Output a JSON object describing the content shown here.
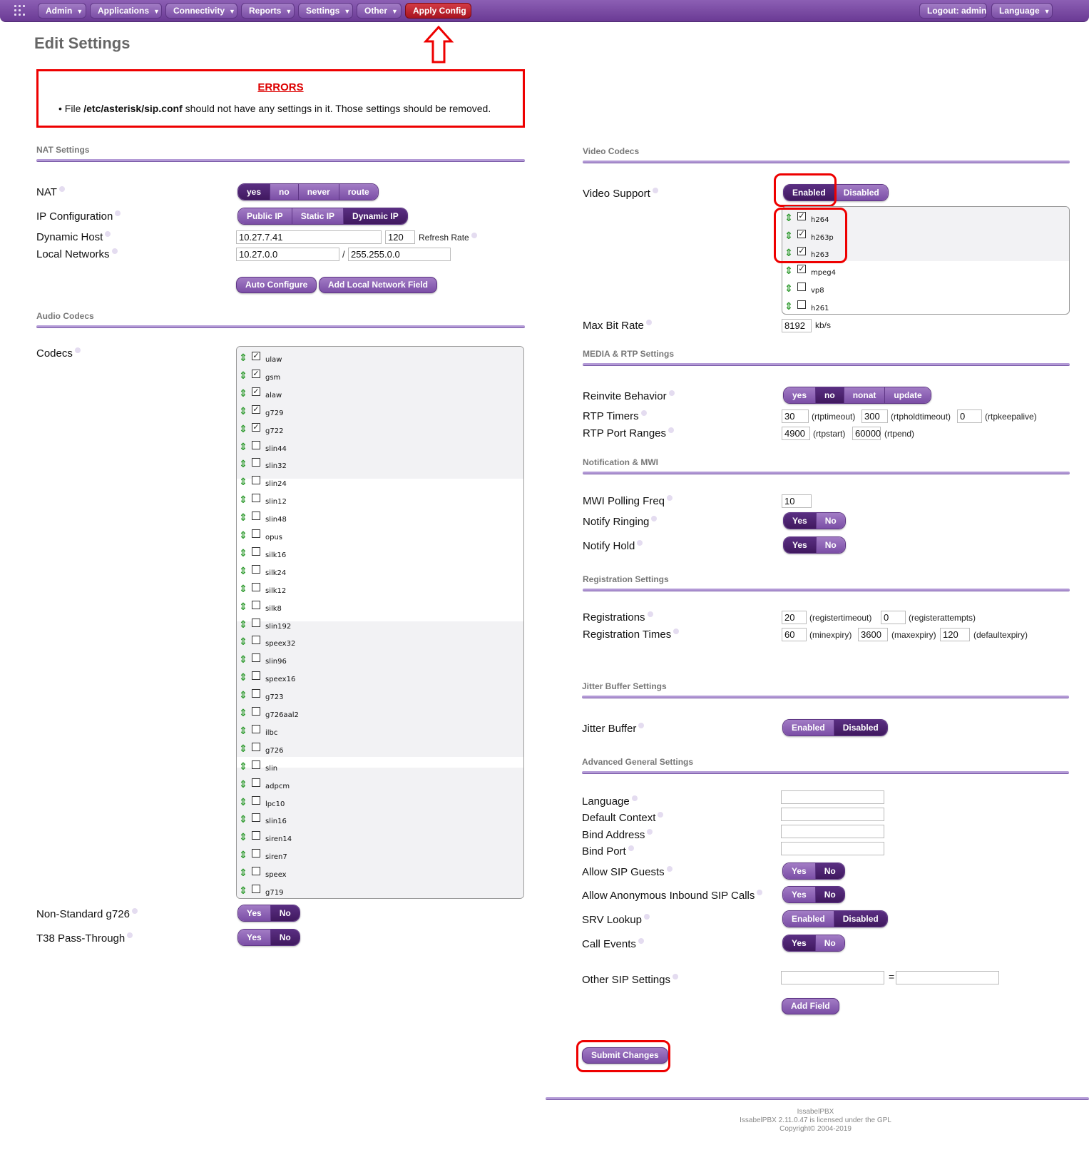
{
  "nav": {
    "items": [
      "Admin",
      "Applications",
      "Connectivity",
      "Reports",
      "Settings",
      "Other"
    ],
    "apply": "Apply Config",
    "logout": "Logout: admin",
    "language": "Language"
  },
  "page_title": "Edit Settings",
  "errors": {
    "title": "ERRORS",
    "msg_prefix": "File ",
    "msg_path": "/etc/asterisk/sip.conf",
    "msg_suffix": " should not have any settings in it. Those settings should be removed."
  },
  "nat": {
    "section": "NAT Settings",
    "nat_label": "NAT",
    "nat_options": [
      "yes",
      "no",
      "never",
      "route"
    ],
    "ipconf_label": "IP Configuration",
    "ipconf_options": [
      "Public IP",
      "Static IP",
      "Dynamic IP"
    ],
    "dynhost_label": "Dynamic Host",
    "dynhost_value": "10.27.7.41",
    "refresh_value": "120",
    "refresh_label": "Refresh Rate",
    "localnet_label": "Local Networks",
    "localnet_ip": "10.27.0.0",
    "localnet_sep": "/",
    "localnet_mask": "255.255.0.0",
    "auto_btn": "Auto Configure",
    "addnet_btn": "Add Local Network Field"
  },
  "audio": {
    "section": "Audio Codecs",
    "codecs_label": "Codecs",
    "codecs": [
      {
        "name": "ulaw",
        "checked": true
      },
      {
        "name": "gsm",
        "checked": true
      },
      {
        "name": "alaw",
        "checked": true
      },
      {
        "name": "g729",
        "checked": true
      },
      {
        "name": "g722",
        "checked": true
      },
      {
        "name": "slin44",
        "checked": false
      },
      {
        "name": "slin32",
        "checked": false
      },
      {
        "name": "slin24",
        "checked": false
      },
      {
        "name": "slin12",
        "checked": false
      },
      {
        "name": "slin48",
        "checked": false
      },
      {
        "name": "opus",
        "checked": false
      },
      {
        "name": "silk16",
        "checked": false
      },
      {
        "name": "silk24",
        "checked": false
      },
      {
        "name": "silk12",
        "checked": false
      },
      {
        "name": "silk8",
        "checked": false
      },
      {
        "name": "slin192",
        "checked": false
      },
      {
        "name": "speex32",
        "checked": false
      },
      {
        "name": "slin96",
        "checked": false
      },
      {
        "name": "speex16",
        "checked": false
      },
      {
        "name": "g723",
        "checked": false
      },
      {
        "name": "g726aal2",
        "checked": false
      },
      {
        "name": "ilbc",
        "checked": false
      },
      {
        "name": "g726",
        "checked": false
      },
      {
        "name": "slin",
        "checked": false
      },
      {
        "name": "adpcm",
        "checked": false
      },
      {
        "name": "lpc10",
        "checked": false
      },
      {
        "name": "slin16",
        "checked": false
      },
      {
        "name": "siren14",
        "checked": false
      },
      {
        "name": "siren7",
        "checked": false
      },
      {
        "name": "speex",
        "checked": false
      },
      {
        "name": "g719",
        "checked": false
      }
    ],
    "g726_label": "Non-Standard g726",
    "t38_label": "T38 Pass-Through",
    "yesno": [
      "Yes",
      "No"
    ]
  },
  "video": {
    "section": "Video Codecs",
    "support_label": "Video Support",
    "support_options": [
      "Enabled",
      "Disabled"
    ],
    "codecs": [
      {
        "name": "h264",
        "checked": true
      },
      {
        "name": "h263p",
        "checked": true
      },
      {
        "name": "h263",
        "checked": true
      },
      {
        "name": "mpeg4",
        "checked": true
      },
      {
        "name": "vp8",
        "checked": false
      },
      {
        "name": "h261",
        "checked": false
      }
    ],
    "maxbit_label": "Max Bit Rate",
    "maxbit_value": "8192",
    "maxbit_unit": "kb/s"
  },
  "media": {
    "section": "MEDIA & RTP Settings",
    "reinvite_label": "Reinvite Behavior",
    "reinvite_options": [
      "yes",
      "no",
      "nonat",
      "update"
    ],
    "rtptimers_label": "RTP Timers",
    "rtptimeout": "30",
    "rtptimeout_label": "(rtptimeout)",
    "rtpholdtimeout": "300",
    "rtpholdtimeout_label": "(rtpholdtimeout)",
    "rtpkeepalive": "0",
    "rtpkeepalive_label": "(rtpkeepalive)",
    "rtpports_label": "RTP Port Ranges",
    "rtpstart": "4900",
    "rtpstart_label": "(rtpstart)",
    "rtpend": "60000",
    "rtpend_label": "(rtpend)"
  },
  "notify": {
    "section": "Notification & MWI",
    "mwi_label": "MWI Polling Freq",
    "mwi_value": "10",
    "ringing_label": "Notify Ringing",
    "hold_label": "Notify Hold"
  },
  "registration": {
    "section": "Registration Settings",
    "reg_label": "Registrations",
    "registertimeout": "20",
    "registertimeout_label": "(registertimeout)",
    "registerattempts": "0",
    "registerattempts_label": "(registerattempts)",
    "times_label": "Registration Times",
    "minexpiry": "60",
    "minexpiry_label": "(minexpiry)",
    "maxexpiry": "3600",
    "maxexpiry_label": "(maxexpiry)",
    "defaultexpiry": "120",
    "defaultexpiry_label": "(defaultexpiry)"
  },
  "jitter": {
    "section": "Jitter Buffer Settings",
    "label": "Jitter Buffer"
  },
  "advanced": {
    "section": "Advanced General Settings",
    "language_label": "Language",
    "context_label": "Default Context",
    "bindaddr_label": "Bind Address",
    "bindport_label": "Bind Port",
    "guests_label": "Allow SIP Guests",
    "anon_label": "Allow Anonymous Inbound SIP Calls",
    "srv_label": "SRV Lookup",
    "callevents_label": "Call Events",
    "other_label": "Other SIP Settings",
    "eq": "=",
    "addfield_btn": "Add Field"
  },
  "submit": "Submit Changes",
  "footer": {
    "line1": "IssabelPBX",
    "line2": "IssabelPBX 2.11.0.47 is licensed under the GPL",
    "line3": "Copyright© 2004-2019"
  },
  "colors": {
    "brand": "#7b4ea6",
    "selected": "#40195f",
    "alert": "#e00000",
    "arrow": "#2e9a2e"
  }
}
